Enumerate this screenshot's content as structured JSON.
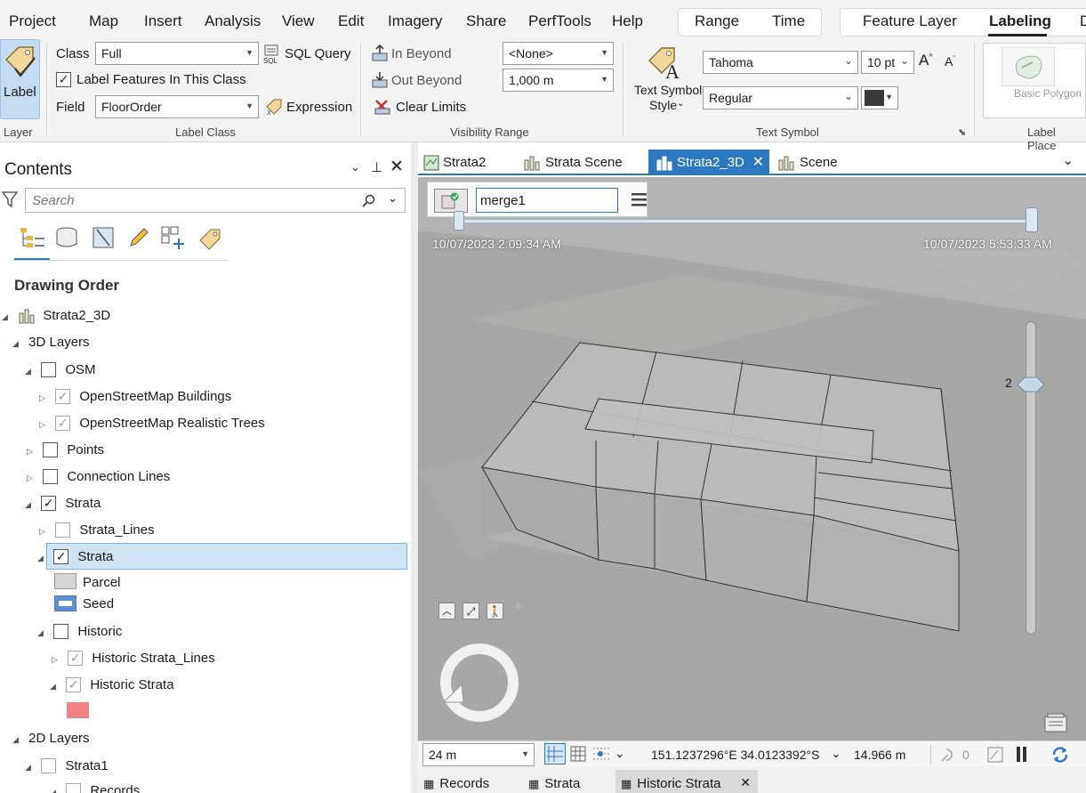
{
  "menu": {
    "items": [
      "Project",
      "Map",
      "Insert",
      "Analysis",
      "View",
      "Edit",
      "Imagery",
      "Share",
      "PerfTools",
      "Help"
    ],
    "context_tabs_a": [
      "Range",
      "Time"
    ],
    "context_tabs_b": [
      "Feature Layer",
      "Labeling",
      "D"
    ]
  },
  "ribbon": {
    "layer_group": {
      "button": "Label",
      "label": "Layer"
    },
    "label_class": {
      "class_label": "Class",
      "class_value": "Full",
      "sql_query": "SQL Query",
      "label_features": "Label Features In This Class",
      "field_label": "Field",
      "field_value": "FloorOrder",
      "expression": "Expression",
      "label": "Label Class"
    },
    "visibility": {
      "in_beyond": "In Beyond",
      "out_beyond": "Out Beyond",
      "clear_limits": "Clear Limits",
      "in_value": "<None>",
      "out_value": "1,000 m",
      "label": "Visibility Range"
    },
    "text_symbol": {
      "style_btn": "Text Symbol",
      "style_btn2": "Style",
      "font": "Tahoma",
      "size": "10 pt",
      "style": "Regular",
      "label": "Text Symbol",
      "color": "#3a3a3a"
    },
    "placement": {
      "gallery_item": "Basic Polygon",
      "label": "Label Place"
    }
  },
  "contents": {
    "title": "Contents",
    "search_placeholder": "Search",
    "section": "Drawing Order",
    "tree": [
      {
        "label": "Strata2_3D"
      },
      {
        "label": "3D Layers"
      },
      {
        "label": "OSM"
      },
      {
        "label": "OpenStreetMap Buildings"
      },
      {
        "label": "OpenStreetMap Realistic Trees"
      },
      {
        "label": "Points"
      },
      {
        "label": "Connection Lines"
      },
      {
        "label": "Strata"
      },
      {
        "label": "Strata_Lines"
      },
      {
        "label": "Strata"
      },
      {
        "label": "Parcel"
      },
      {
        "label": "Seed"
      },
      {
        "label": "Historic"
      },
      {
        "label": "Historic Strata_Lines"
      },
      {
        "label": "Historic Strata"
      },
      {
        "label": "2D Layers"
      },
      {
        "label": "Strata1"
      },
      {
        "label": "Records"
      }
    ],
    "colors": {
      "parcel": "#d6d6d6",
      "seed": "#5b8fd9",
      "historic": "#f48282"
    }
  },
  "views": {
    "tabs": [
      "Strata2",
      "Strata Scene",
      "Strata2_3D",
      "Scene"
    ],
    "active": "Strata2_3D"
  },
  "map": {
    "layer_name": "merge1",
    "time_start": "10/07/2023 2:09:34 AM",
    "time_end": "10/07/2023 5:53:33 AM",
    "slider_value": "2"
  },
  "status": {
    "scale": "24 m",
    "coords": "151.1237296°E 34.0123392°S",
    "elevation": "14.966 m",
    "selected_count": "0"
  },
  "bottom_tabs": [
    "Records",
    "Strata",
    "Historic Strata"
  ]
}
